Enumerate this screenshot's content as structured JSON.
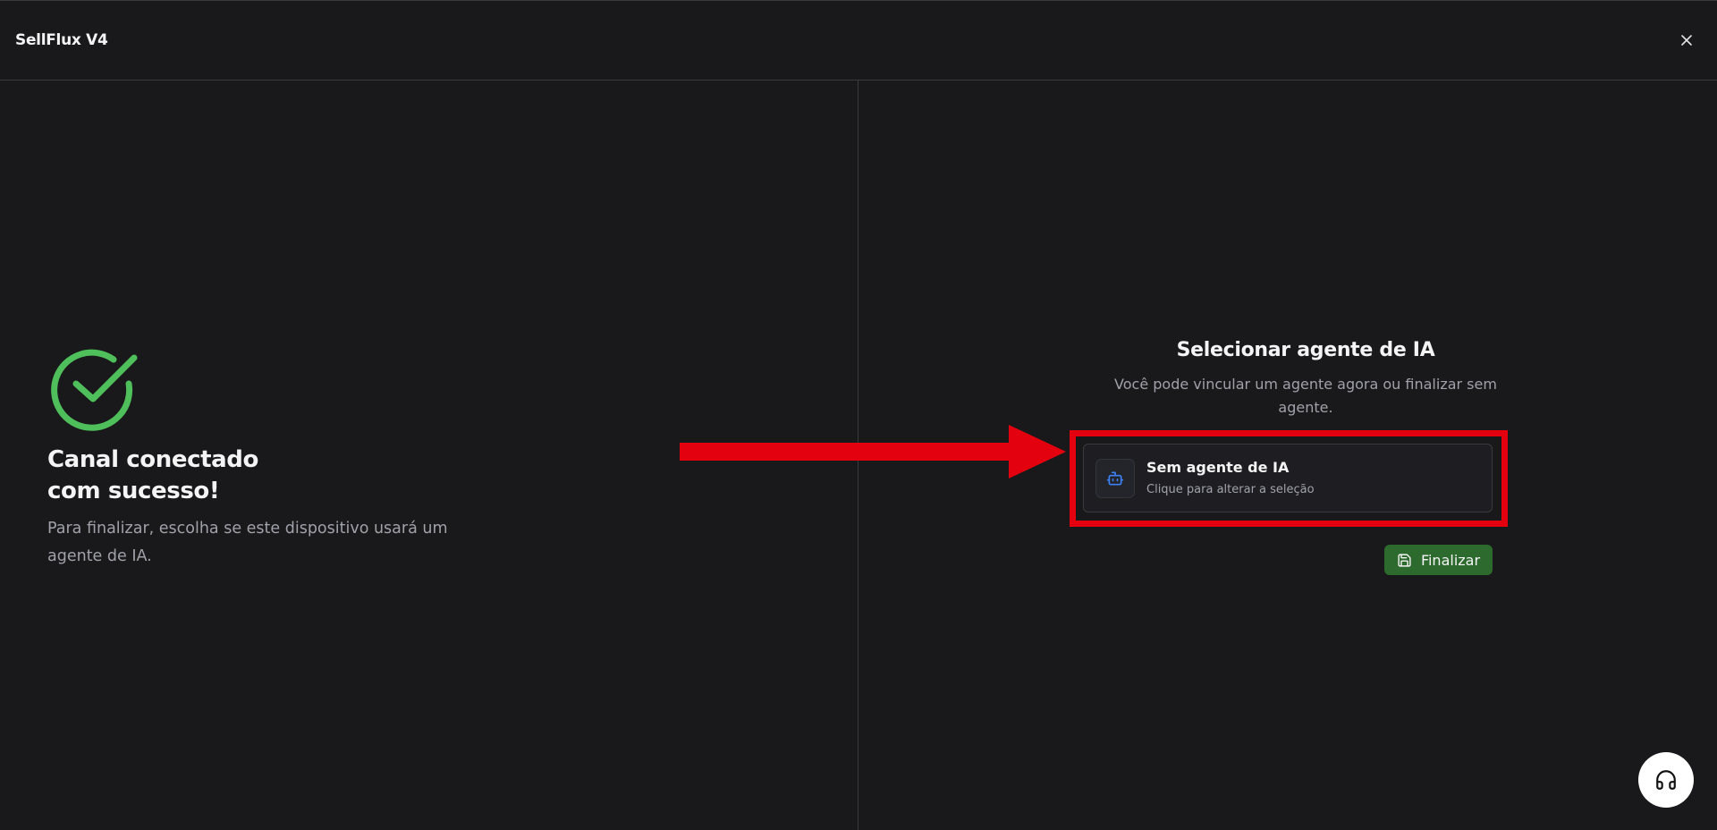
{
  "header": {
    "app_title": "SellFlux V4",
    "close_icon": "close-icon"
  },
  "left_panel": {
    "icon": "check-circle-icon",
    "title_line1": "Canal conectado",
    "title_line2": "com sucesso!",
    "description": "Para finalizar, escolha se este dispositivo usará um agente de IA."
  },
  "right_panel": {
    "title": "Selecionar agente de IA",
    "description": "Você pode vincular um agente agora ou finalizar sem agente.",
    "agent_card": {
      "icon": "bot-icon",
      "name": "Sem agente de IA",
      "hint": "Clique para alterar a seleção"
    },
    "finish_button": {
      "icon": "save-icon",
      "label": "Finalizar"
    }
  },
  "support": {
    "icon": "headset-icon"
  },
  "colors": {
    "background": "#19191b",
    "success_green": "#4fbf5b",
    "finish_button": "#2d6a2e",
    "annotation_red": "#e3000f",
    "bot_icon_blue": "#3b82f6"
  }
}
